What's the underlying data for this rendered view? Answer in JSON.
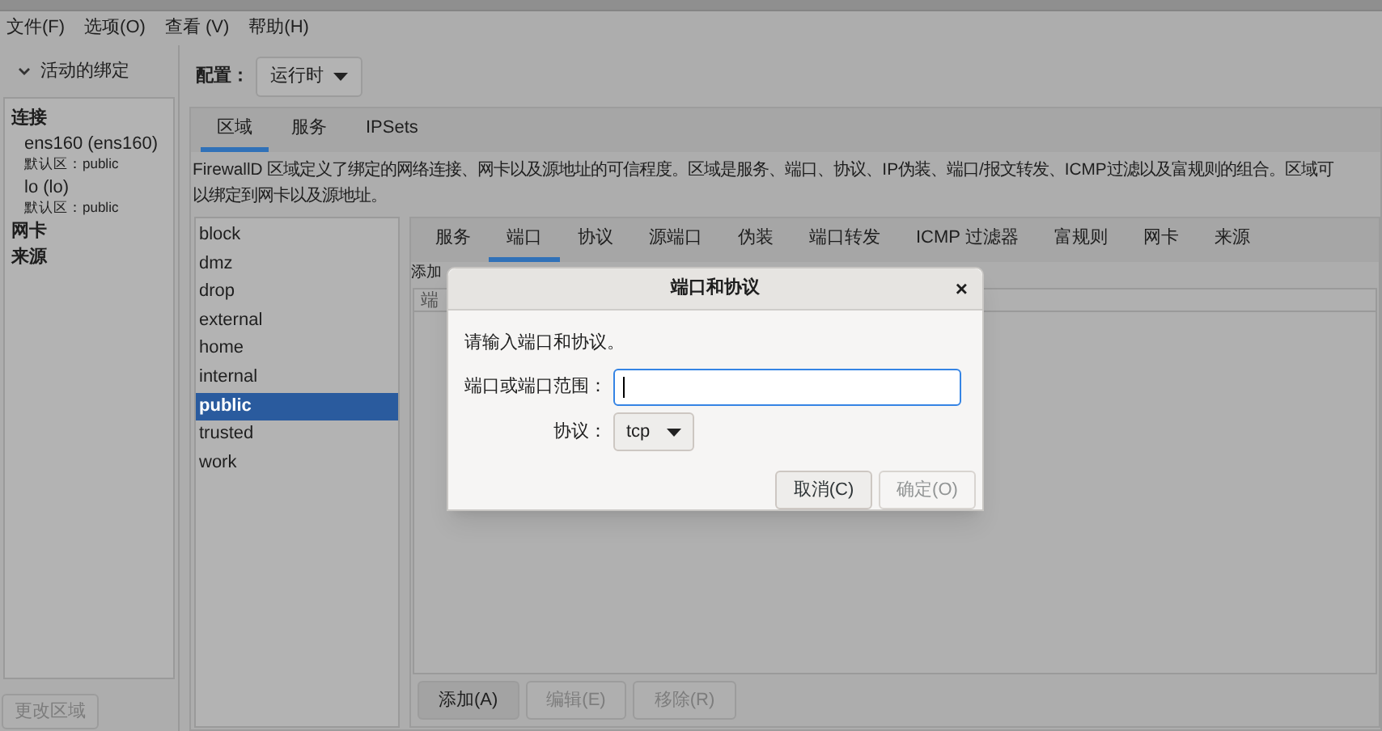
{
  "menu": [
    "文件(F)",
    "选项(O)",
    "查看 (V)",
    "帮助(H)"
  ],
  "bindings": {
    "title": "活动的绑定",
    "expanded": true,
    "groups": [
      {
        "label": "连接",
        "items": [
          {
            "name": "ens160 (ens160)",
            "zone": "默认区：public"
          },
          {
            "name": "lo (lo)",
            "zone": "默认区：public"
          }
        ]
      },
      {
        "label": "网卡"
      },
      {
        "label": "来源"
      }
    ],
    "change_zone_button": "更改区域"
  },
  "config": {
    "label": "配置：",
    "value": "运行时"
  },
  "top_tabs": [
    {
      "label": "区域",
      "selected": true
    },
    {
      "label": "服务",
      "selected": false
    },
    {
      "label": "IPSets",
      "selected": false
    }
  ],
  "description_lines": [
    "FirewallD 区域定义了绑定的网络连接、网卡以及源地址的可信程度。区域是服务、端口、协议、IP伪装、端口/报文转发、ICMP过滤以及富规则的组合。区域可",
    "以绑定到网卡以及源地址。"
  ],
  "zones": [
    {
      "label": "block",
      "selected": false
    },
    {
      "label": "dmz",
      "selected": false
    },
    {
      "label": "drop",
      "selected": false
    },
    {
      "label": "external",
      "selected": false
    },
    {
      "label": "home",
      "selected": false
    },
    {
      "label": "internal",
      "selected": false
    },
    {
      "label": "public",
      "selected": true
    },
    {
      "label": "trusted",
      "selected": false
    },
    {
      "label": "work",
      "selected": false
    }
  ],
  "zone_tabs": [
    {
      "label": "服务",
      "selected": false
    },
    {
      "label": "端口",
      "selected": true
    },
    {
      "label": "协议",
      "selected": false
    },
    {
      "label": "源端口",
      "selected": false
    },
    {
      "label": "伪装",
      "selected": false
    },
    {
      "label": "端口转发",
      "selected": false
    },
    {
      "label": "ICMP 过滤器",
      "selected": false
    },
    {
      "label": "富规则",
      "selected": false
    },
    {
      "label": "网卡",
      "selected": false
    },
    {
      "label": "来源",
      "selected": false
    }
  ],
  "ports_hint": "添加",
  "table": {
    "columns": [
      "端"
    ]
  },
  "actions": [
    {
      "label": "添加(A)",
      "disabled": false
    },
    {
      "label": "编辑(E)",
      "disabled": true
    },
    {
      "label": "移除(R)",
      "disabled": true
    }
  ],
  "dialog": {
    "title": "端口和协议",
    "close": "×",
    "prompt": "请输入端口和协议。",
    "port_label": "端口或端口范围：",
    "protocol_label": "协议：",
    "protocol": "tcp",
    "buttons": [
      {
        "label": "取消(C)",
        "disabled": false
      },
      {
        "label": "确定(O)",
        "disabled": true
      }
    ]
  }
}
